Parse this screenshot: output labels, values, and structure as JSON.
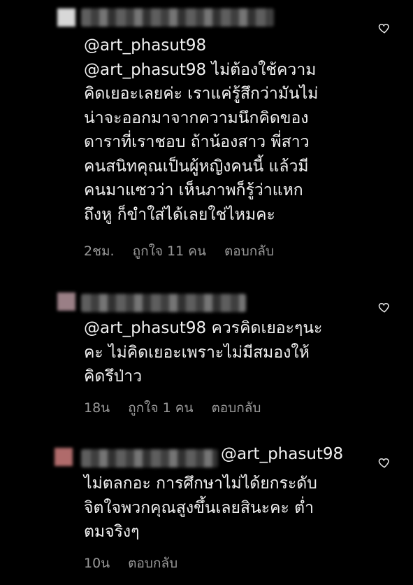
{
  "comments": [
    {
      "mention": "@art_phasut98",
      "lines": [
        "@art_phasut98 ไม่ต้องใช้ความ",
        "คิดเยอะเลยค่ะ เราแค่รู้สึกว่ามันไม่",
        "น่าจะออกมาจากความนึกคิดของ",
        "ดาราที่เราชอบ ถ้าน้องสาว พี่สาว",
        "คนสนิทคุณเป็นผู้หญิงคนนี้ แล้วมี",
        "คนมาแซวว่า เห็นภาพก็รู้ว่าแหก",
        "ถึงหู ก็ขำใส่ได้เลยใช่ไหมคะ"
      ],
      "time": "2ชม.",
      "likes": "ถูกใจ 11 คน",
      "reply": "ตอบกลับ"
    },
    {
      "lines": [
        "@art_phasut98 ควรคิดเยอะๆนะ",
        "คะ ไม่คิดเยอะเพราะไม่มีสมองให้",
        "คิดรึป่าว"
      ],
      "time": "18น",
      "likes": "ถูกใจ 1 คน",
      "reply": "ตอบกลับ"
    },
    {
      "mention": "@art_phasut98",
      "lines": [
        "ไม่ตลกอะ การศึกษาไม่ได้ยกระดับ",
        "จิตใจพวกคุณสูงขึ้นเลยสินะคะ ต่ำ",
        "ตมจริงๆ"
      ],
      "time": "10น",
      "reply": "ตอบกลับ"
    }
  ],
  "icons": {
    "like": "heart-outline-icon"
  },
  "colors": {
    "background": "#000000",
    "text": "#f0f0f0",
    "meta": "#9a9a9a"
  }
}
